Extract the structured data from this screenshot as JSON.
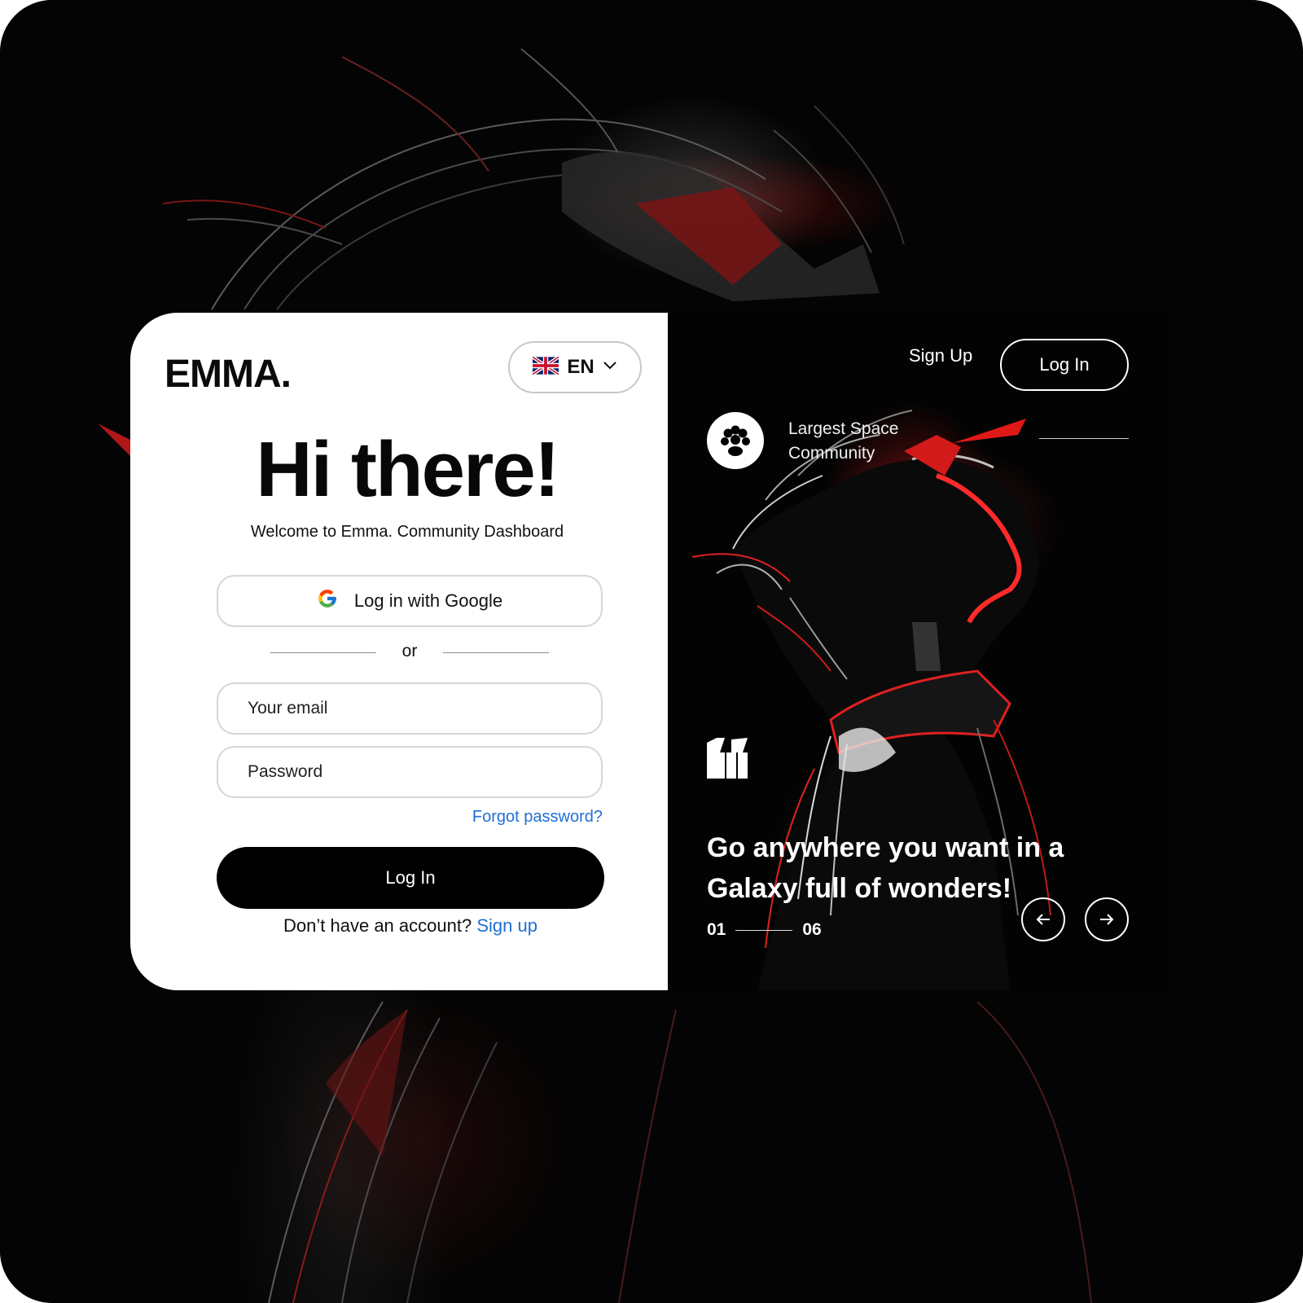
{
  "brand": {
    "logo": "EMMA."
  },
  "language": {
    "selected": "EN",
    "flag_icon": "uk-flag-icon"
  },
  "login": {
    "heading": "Hi there!",
    "subheading": "Welcome to Emma. Community Dashboard",
    "google_label": "Log in with Google",
    "divider_text": "or",
    "email_placeholder": "Your email",
    "password_placeholder": "Password",
    "forgot_label": "Forgot password?",
    "submit_label": "Log In",
    "signup_prompt": "Don’t have an account?",
    "signup_link": "Sign up"
  },
  "nav": {
    "signup_label": "Sign Up",
    "login_label": "Log In"
  },
  "community": {
    "label": "Largest Space Community"
  },
  "testimonial": {
    "quote": "Go anywhere you want in a Galaxy full of wonders!",
    "current": "01",
    "total": "06"
  },
  "colors": {
    "accent": "#1f6fd6",
    "primary_button": "#000000",
    "background": "#050505",
    "art_red": "#e02020"
  },
  "icons": {
    "google": "google-icon",
    "chevron": "chevron-down-icon",
    "quote": "quote-icon",
    "prev": "arrow-left-icon",
    "next": "arrow-right-icon",
    "community": "paw-icon"
  }
}
